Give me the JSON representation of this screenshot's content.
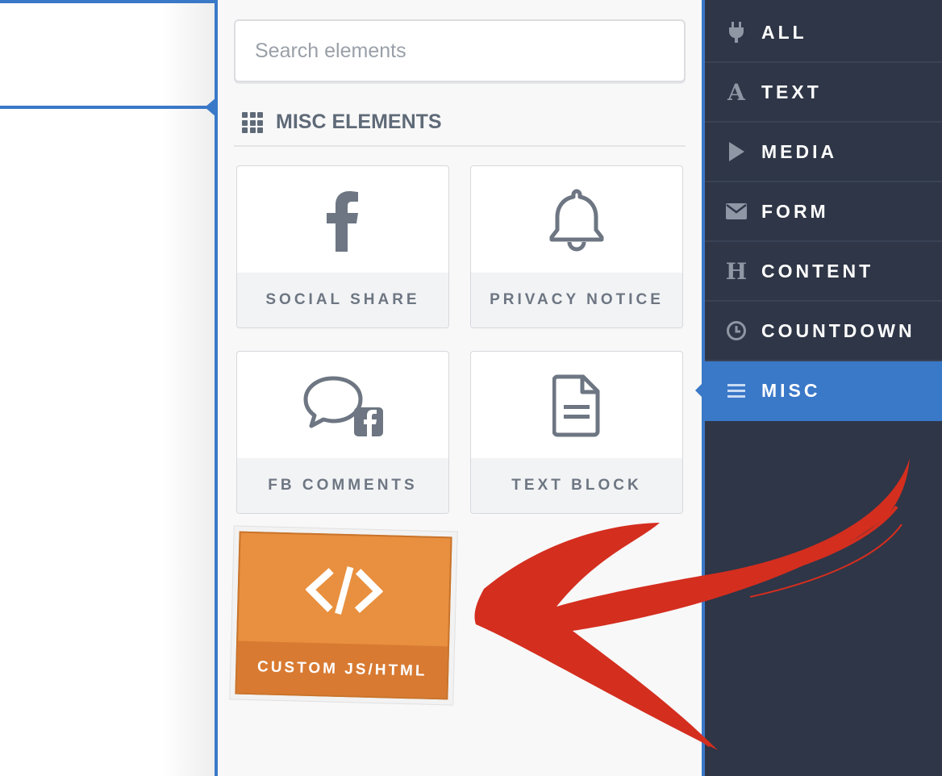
{
  "search": {
    "placeholder": "Search elements"
  },
  "section": {
    "title": "MISC ELEMENTS",
    "icon": "grid-icon"
  },
  "elements": [
    {
      "label": "SOCIAL SHARE",
      "icon": "facebook-icon"
    },
    {
      "label": "PRIVACY NOTICE",
      "icon": "bell-icon"
    },
    {
      "label": "FB COMMENTS",
      "icon": "speech-bubble-facebook-icon"
    },
    {
      "label": "TEXT BLOCK",
      "icon": "document-icon"
    },
    {
      "label": "CUSTOM JS/HTML",
      "icon": "code-icon",
      "highlighted": true
    }
  ],
  "categories": [
    {
      "label": "ALL",
      "icon": "plug-icon"
    },
    {
      "label": "TEXT",
      "icon": "letter-a-icon"
    },
    {
      "label": "MEDIA",
      "icon": "play-icon"
    },
    {
      "label": "FORM",
      "icon": "envelope-icon"
    },
    {
      "label": "CONTENT",
      "icon": "letter-h-icon"
    },
    {
      "label": "COUNTDOWN",
      "icon": "clock-icon"
    },
    {
      "label": "MISC",
      "icon": "hamburger-icon",
      "active": true
    }
  ],
  "colors": {
    "accent": "#3a78c8",
    "sidebar_bg": "#2e3647",
    "highlight_card": "#e8903f",
    "annotation_arrow": "#d42e1f"
  }
}
